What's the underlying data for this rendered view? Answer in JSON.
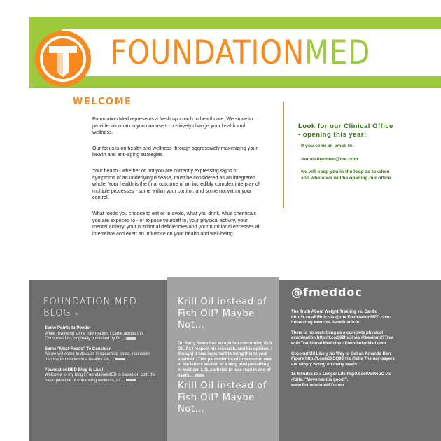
{
  "brand": {
    "name_part1": "FOUNDATION",
    "name_part2": "MED",
    "logo_icon": "foundationmed-logo",
    "colors": {
      "green": "#9dca3c",
      "orange": "#f7891f",
      "dark_green": "#3a6d1b",
      "gray": "#6e6e6e",
      "light_gray": "#a3a3a3"
    }
  },
  "welcome": {
    "heading": "WELCOME",
    "paragraphs": [
      "Foundation Med represents a fresh approach to healthcare. We strive to provide information you can use to positively change your health and wellness.",
      "Our focus is on health and wellness through aggressively maximizing your health and anti-aging strategies.",
      "Your health - whether or not you are currently expressing signs or symptoms of an underlying disease, must be considered as an integrated whole. Your health is the final outcome of an incredibly complex interplay of multiple processes - some within your control, and some not within your control.",
      "What foods you choose to eat or to avoid, what you drink, what chemicals you are exposed to - or expose yourself to, your physical activity, your mental activity, your nutritional deficiencies and your nutritional excesses all interrelate and exert an influence on your health and well-being."
    ]
  },
  "clinic": {
    "heading": "Look for our Clinical Office - opening this year!",
    "line1": "If you send an email to:",
    "email": "foundationmed@me.com",
    "line2": "we will keep you in the loop as to when and where we will be opening our office."
  },
  "blog": {
    "title_line1": "FOUNDATION MED",
    "title_line2": "BLOG",
    "arrow": "»",
    "posts": [
      {
        "title": "Some Points to Ponder",
        "excerpt": "While reviewing some information, I came across this Christmas List, originally published by Dr…"
      },
      {
        "title": "Some \"Must-Reads\" To Consider",
        "excerpt": "As we will come to discuss in upcoming posts, I consider that the foundation to a healthy life,…"
      },
      {
        "title": "FoundationMED Blog is Live!",
        "excerpt": "Welcome to my blog ! FoundationMED is based on both the basic principle of enhancing wellness, as…"
      }
    ]
  },
  "krill": {
    "title": "Krill Oil instead of Fish Oil? Maybe Not…",
    "body": "Dr. Barry Sears has an opinion concerning Krill Oil. As I respect his research, and his opinion, I thought it was important to bring this to your attention. This particular bit of information was in the letters section of a blog post pertaining to oxidized LDL particles (a nice read in and of itself)…"
  },
  "twitter": {
    "handle": "@fmeddoc",
    "tweets": [
      "The Truth About Weight Training vs. Cardio http://t.co/aEtRuic via @zite FoundationMED.com-Interesting exercise benefit article",
      "There is no such thing as a complete physical examination http://t.co/362huJi via @kevinmd?True with Traditional Medicine - FoundationMed.com",
      "Coconut Oil Likely No Way to Get an Amanda Kerr Figure http://t.co/k5XSQ9J via @zite The nay-sayers are simply wrong on many levels.",
      "15 Minutes to a Longer Life http://t.co/Vs4touO via @zite. \"Movement is good!\". www.FoundationMED.com"
    ]
  }
}
